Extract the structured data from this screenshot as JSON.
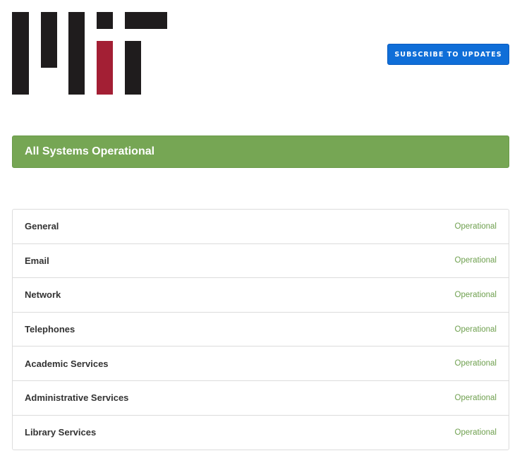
{
  "brand": {
    "logo_text": "MIT",
    "colors": {
      "black": "#1f1c1d",
      "red": "#a31f34"
    }
  },
  "header": {
    "subscribe_label": "SUBSCRIBE TO UPDATES"
  },
  "banner": {
    "text": "All Systems Operational"
  },
  "components": [
    {
      "name": "General",
      "status": "Operational"
    },
    {
      "name": "Email",
      "status": "Operational"
    },
    {
      "name": "Network",
      "status": "Operational"
    },
    {
      "name": "Telephones",
      "status": "Operational"
    },
    {
      "name": "Academic Services",
      "status": "Operational"
    },
    {
      "name": "Administrative Services",
      "status": "Operational"
    },
    {
      "name": "Library Services",
      "status": "Operational"
    }
  ],
  "colors": {
    "accent": "#0f6ed8",
    "ok": "#76a654",
    "ok_text": "#6fa04f"
  }
}
